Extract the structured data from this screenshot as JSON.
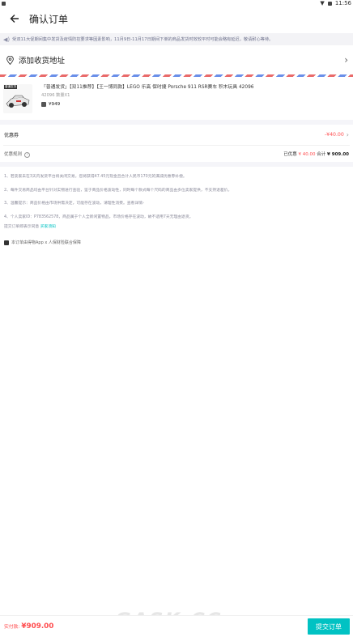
{
  "status_bar": {
    "time": "11:56"
  },
  "header": {
    "title": "确认订单"
  },
  "notice": {
    "text": "受双11大促期间集中发货及疫情防控要求等因素影响，11月9日-11月17日期间下单的商品发货时效较平时可能会略有延迟，敬请耐心等待。"
  },
  "address": {
    "label": "添加收货地址"
  },
  "product": {
    "tag": "普通发货",
    "name": "「普通发货」【双11推荐】【王一博同款】LEGO 乐高 保时捷 Porsche 911 RSR赛车 积木玩具 42096",
    "sub": "42096 数量X1",
    "price": "¥949"
  },
  "coupon": {
    "label": "优惠券",
    "value": "-¥40.00"
  },
  "rule": {
    "label": "优惠规则",
    "discount_label": "已优惠",
    "discount_value": "¥ 40.00",
    "total_label": "合计",
    "total_value": "¥ 909.00"
  },
  "terms": [
    "1、若卖家未在3天内发货平台将关闭交易。您将获得47.45元现金且合计人民币170元的满减优惠券补偿。",
    "2、每件交易商品均由平台针对实物进行查验，鉴于商品价格波动性，同时每个款式每个尺码的商品由多位卖家提供，不支持退差价。",
    "3、温馨提示：商品价格由市场供需决定，可能存在波动，请理性消费。查看详情›",
    "4、个人卖家ID：P783562578，商品属于个人全新闲置物品，市场价格存在波动，故不适用7天无理由退货。"
  ],
  "agree": {
    "text": "提交订单即表示同意",
    "link": "买家须知"
  },
  "guarantee": {
    "text": "本订单由得物App x 人保财险联合保障"
  },
  "bottom": {
    "pay_label": "实付款:",
    "pay_amount": "¥909.00",
    "submit_label": "提交订单"
  },
  "watermark": {
    "text": "GASK.CC"
  },
  "colors": {
    "accent": "#01c2c3",
    "price_red": "#ff4d4f"
  },
  "icons": [
    "back-arrow-icon",
    "speaker-icon",
    "location-pin-icon",
    "chevron-right-icon",
    "question-icon",
    "shield-icon"
  ]
}
